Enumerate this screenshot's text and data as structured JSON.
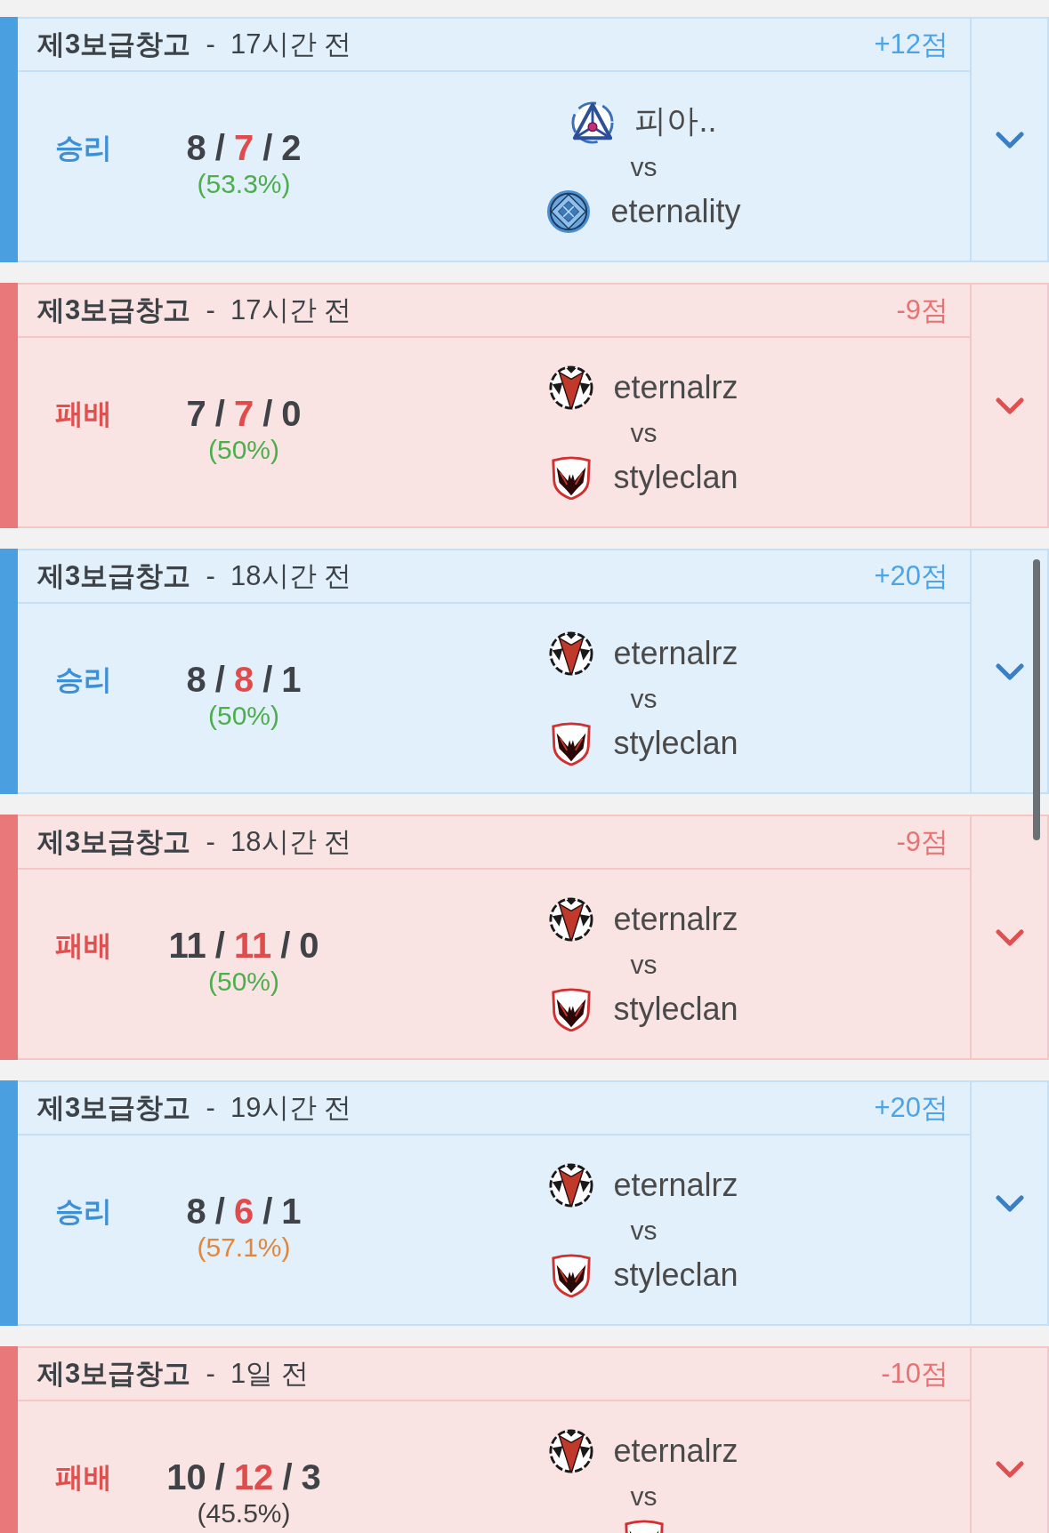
{
  "matches": [
    {
      "won": true,
      "title": "**제3보급창고**  -  17시간 전",
      "score": "+12점",
      "result": "승리",
      "kda": [
        {
          "kind": "kills",
          "text": "8"
        },
        {
          "kind": "sep",
          "text": "/"
        },
        {
          "kind": "deaths",
          "text": "7"
        },
        {
          "kind": "sep",
          "text": "/"
        },
        {
          "kind": "assists",
          "text": "2"
        }
      ],
      "rate": {
        "text": "(53.3%)",
        "color": "#4cae4c"
      },
      "teams": [
        {
          "kind": "tri",
          "name": "피아.."
        },
        {
          "kind": "disc",
          "name": "eternality"
        }
      ],
      "vs": "vs"
    },
    {
      "won": false,
      "title": "**제3보급창고**  -  17시간 전",
      "score": "-9점",
      "result": "패배",
      "kda": [
        {
          "kind": "kills",
          "text": "7"
        },
        {
          "kind": "sep",
          "text": "/"
        },
        {
          "kind": "deaths",
          "text": "7"
        },
        {
          "kind": "sep",
          "text": "/"
        },
        {
          "kind": "assists",
          "text": "0"
        }
      ],
      "rate": {
        "text": "(50%)",
        "color": "#4cae4c"
      },
      "teams": [
        {
          "kind": "fang",
          "name": "eternalrz"
        },
        {
          "kind": "wing",
          "name": "styleclan"
        }
      ],
      "vs": "vs"
    },
    {
      "won": true,
      "title": "**제3보급창고**  -  18시간 전",
      "score": "+20점",
      "result": "승리",
      "kda": [
        {
          "kind": "kills",
          "text": "8"
        },
        {
          "kind": "sep",
          "text": "/"
        },
        {
          "kind": "deaths",
          "text": "8"
        },
        {
          "kind": "sep",
          "text": "/"
        },
        {
          "kind": "assists",
          "text": "1"
        }
      ],
      "rate": {
        "text": "(50%)",
        "color": "#4cae4c"
      },
      "teams": [
        {
          "kind": "fang",
          "name": "eternalrz"
        },
        {
          "kind": "wing",
          "name": "styleclan"
        }
      ],
      "vs": "vs"
    },
    {
      "won": false,
      "title": "**제3보급창고**  -  18시간 전",
      "score": "-9점",
      "result": "패배",
      "kda": [
        {
          "kind": "kills",
          "text": "11"
        },
        {
          "kind": "sep",
          "text": "/"
        },
        {
          "kind": "deaths",
          "text": "11"
        },
        {
          "kind": "sep",
          "text": "/"
        },
        {
          "kind": "assists",
          "text": "0"
        }
      ],
      "rate": {
        "text": "(50%)",
        "color": "#4cae4c"
      },
      "teams": [
        {
          "kind": "fang",
          "name": "eternalrz"
        },
        {
          "kind": "wing",
          "name": "styleclan"
        }
      ],
      "vs": "vs"
    },
    {
      "won": true,
      "title": "**제3보급창고**  -  19시간 전",
      "score": "+20점",
      "result": "승리",
      "kda": [
        {
          "kind": "kills",
          "text": "8"
        },
        {
          "kind": "sep",
          "text": "/"
        },
        {
          "kind": "deaths",
          "text": "6"
        },
        {
          "kind": "sep",
          "text": "/"
        },
        {
          "kind": "assists",
          "text": "1"
        }
      ],
      "rate": {
        "text": "(57.1%)",
        "color": "#e0873d"
      },
      "teams": [
        {
          "kind": "fang",
          "name": "eternalrz"
        },
        {
          "kind": "wing",
          "name": "styleclan"
        }
      ],
      "vs": "vs"
    },
    {
      "won": false,
      "title": "**제3보급창고**  -  1일 전",
      "score": "-10점",
      "result": "패배",
      "kda": [
        {
          "kind": "kills",
          "text": "10"
        },
        {
          "kind": "sep",
          "text": "/"
        },
        {
          "kind": "deaths",
          "text": "12"
        },
        {
          "kind": "sep",
          "text": "/"
        },
        {
          "kind": "assists",
          "text": "3"
        }
      ],
      "rate": {
        "text": "(45.5%)",
        "color": "#404040"
      },
      "teams": [
        {
          "kind": "fang",
          "name": "eternalrz"
        },
        {
          "kind": "wing"
        }
      ],
      "vs": "vs"
    }
  ]
}
